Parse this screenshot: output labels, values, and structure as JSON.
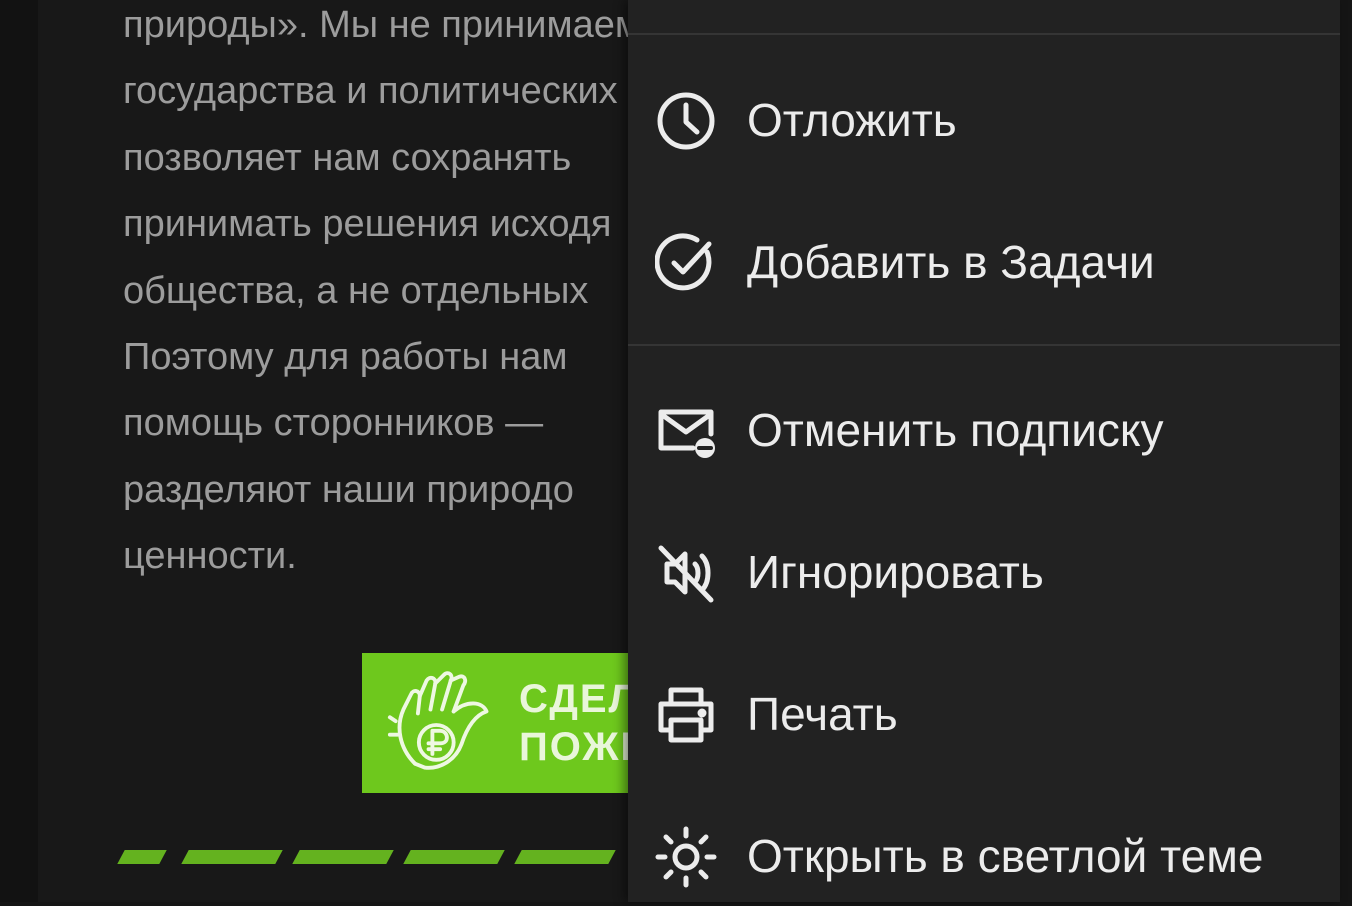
{
  "email": {
    "paragraph_lines": [
      "природы». Мы не принимаем",
      "государства и политических",
      "позволяет нам сохранять",
      "принимать решения исходя",
      "общества, а не отдельных",
      "Поэтому для работы нам",
      "помощь сторонников —",
      "разделяют наши природо",
      "ценности."
    ],
    "donate_button": {
      "line1": "СДЕЛАТЬ",
      "line2": "ПОЖЕРТВОВАНИЕ",
      "color": "#6ec81d"
    }
  },
  "menu": {
    "items": [
      {
        "label": "Отложить",
        "icon": "clock-icon"
      },
      {
        "label": "Добавить в Задачи",
        "icon": "check-circle-icon"
      },
      {
        "label": "Отменить подписку",
        "icon": "mail-minus-icon"
      },
      {
        "label": "Игнорировать",
        "icon": "mute-icon"
      },
      {
        "label": "Печать",
        "icon": "printer-icon"
      },
      {
        "label": "Открыть в светлой теме",
        "icon": "sun-icon"
      }
    ]
  },
  "colors": {
    "menu_background": "#222222",
    "page_background": "#181818",
    "accent_green": "#6ec81d",
    "menu_text": "#ececec",
    "body_text": "#9c9c9c"
  }
}
